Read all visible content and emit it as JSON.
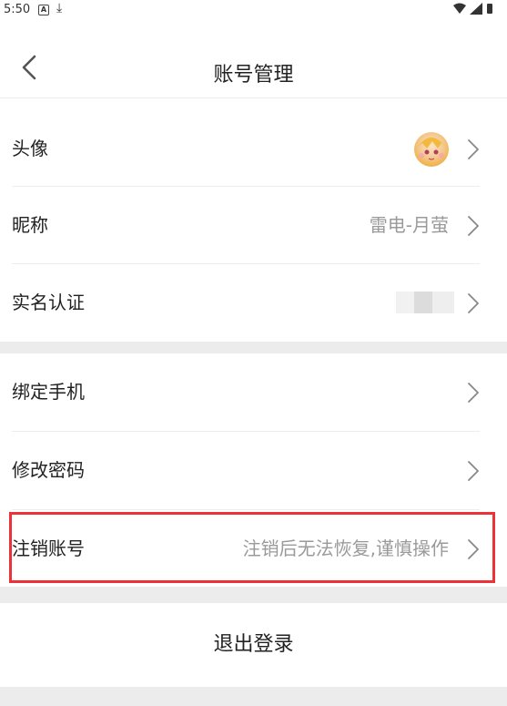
{
  "status_bar": {
    "time": "5:50",
    "icons": [
      "a-icon",
      "download-icon",
      "wifi-icon",
      "signal-icon",
      "battery-icon"
    ]
  },
  "header": {
    "title": "账号管理",
    "back_icon": "chevron-left-icon"
  },
  "profile_section": [
    {
      "label": "头像",
      "value": "",
      "type": "avatar"
    },
    {
      "label": "昵称",
      "value": "雷电-月萤"
    },
    {
      "label": "实名认证",
      "value": "",
      "type": "blurred"
    }
  ],
  "security_section": [
    {
      "label": "绑定手机",
      "value": ""
    },
    {
      "label": "修改密码",
      "value": ""
    },
    {
      "label": "注销账号",
      "value": "注销后无法恢复,谨慎操作",
      "highlighted": true
    }
  ],
  "logout_label": "退出登录",
  "colors": {
    "background": "#ececec",
    "card": "#ffffff",
    "highlight": "#ec3137",
    "muted_text": "#9a9a9a"
  }
}
